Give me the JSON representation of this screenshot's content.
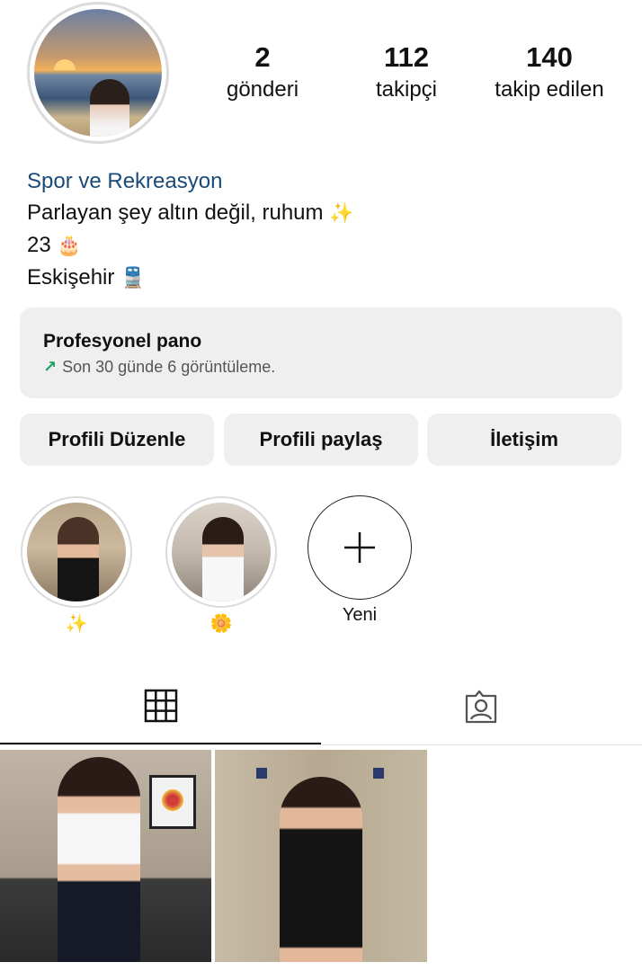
{
  "profile": {
    "stats": {
      "posts": {
        "value": "2",
        "label": "gönderi"
      },
      "followers": {
        "value": "112",
        "label": "takipçi"
      },
      "following": {
        "value": "140",
        "label": "takip edilen"
      }
    },
    "bio": {
      "category": "Spor ve Rekreasyon",
      "line1": "Parlayan şey altın değil, ruhum",
      "line1_emoji": "✨",
      "line2": "23",
      "line2_emoji": "🎂",
      "line3": "Eskişehir",
      "line3_emoji": "🚆"
    }
  },
  "dashboard": {
    "title": "Profesyonel pano",
    "arrow": "↗",
    "subtitle": "Son 30 günde 6 görüntüleme."
  },
  "buttons": {
    "edit": "Profili Düzenle",
    "share": "Profili paylaş",
    "contact": "İletişim"
  },
  "highlights": [
    {
      "label": "✨"
    },
    {
      "label": "🌼"
    },
    {
      "label": "Yeni",
      "icon": "plus-icon"
    }
  ],
  "tabs": [
    {
      "name": "grid",
      "icon": "grid-icon",
      "active": true
    },
    {
      "name": "tagged",
      "icon": "tagged-person-icon",
      "active": false
    }
  ],
  "colors": {
    "category": "#1a4a7a",
    "button_bg": "#efefef",
    "trend_arrow": "#1aa260"
  }
}
